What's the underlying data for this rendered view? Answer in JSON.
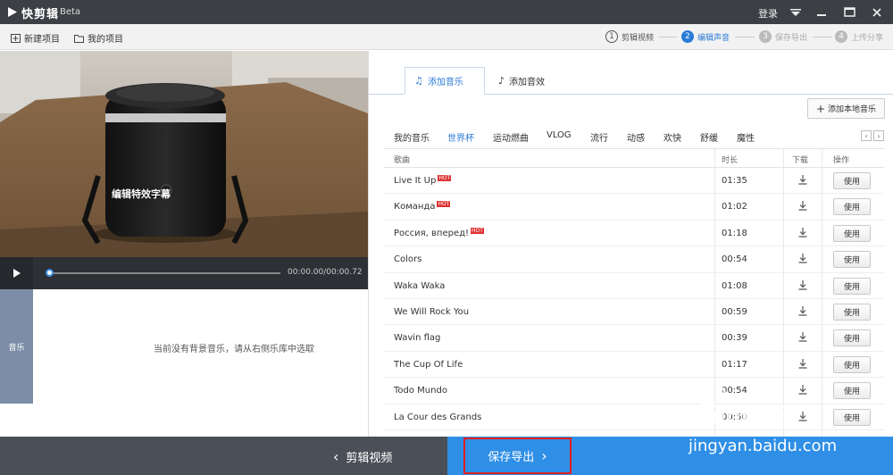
{
  "titlebar": {
    "app_title": "快剪辑",
    "beta": "Beta",
    "login": "登录"
  },
  "toolbar": {
    "new_project": "新建项目",
    "my_projects": "我的项目",
    "steps": [
      {
        "num": "1",
        "label": "剪辑视频"
      },
      {
        "num": "2",
        "label": "编辑声音"
      },
      {
        "num": "3",
        "label": "保存导出"
      },
      {
        "num": "4",
        "label": "上传分享"
      }
    ]
  },
  "preview": {
    "caption": "编辑特效字幕",
    "time": "00:00.00/00:00.72",
    "progress": 0
  },
  "music_track": {
    "label": "音乐",
    "empty_hint": "当前没有背景音乐，请从右侧乐库中选取"
  },
  "tabs": [
    {
      "label": "添加音乐",
      "icon": "music-note-icon"
    },
    {
      "label": "添加音效",
      "icon": "sound-effect-icon"
    }
  ],
  "add_local_music": "添加本地音乐",
  "categories": [
    "我的音乐",
    "世界杯",
    "运动燃曲",
    "VLOG",
    "流行",
    "动感",
    "欢快",
    "舒缓",
    "魔性"
  ],
  "table": {
    "headers": {
      "song": "歌曲",
      "duration": "时长",
      "download": "下载",
      "action": "操作"
    },
    "use_label": "使用",
    "hot_badge": "HOT",
    "rows": [
      {
        "name": "Live It Up",
        "hot": true,
        "duration": "01:35"
      },
      {
        "name": "Команда",
        "hot": true,
        "duration": "01:02"
      },
      {
        "name": "Россия, вперед!",
        "hot": true,
        "duration": "01:18"
      },
      {
        "name": "Colors",
        "hot": false,
        "duration": "00:54"
      },
      {
        "name": "Waka Waka",
        "hot": false,
        "duration": "01:08"
      },
      {
        "name": "We Will Rock You",
        "hot": false,
        "duration": "00:59"
      },
      {
        "name": "Wavin flag",
        "hot": false,
        "duration": "00:39"
      },
      {
        "name": "The Cup Of Life",
        "hot": false,
        "duration": "01:17"
      },
      {
        "name": "Todo Mundo",
        "hot": false,
        "duration": "00:54"
      },
      {
        "name": "La Cour des Grands",
        "hot": false,
        "duration": "00:50"
      }
    ]
  },
  "bottom": {
    "back": "剪辑视频",
    "save": "保存导出"
  },
  "watermark": {
    "brand": "Baidu经验",
    "url": "jingyan.baidu.com"
  },
  "colors": {
    "accent": "#2b7bd6",
    "save_bar": "#2f8fe6",
    "highlight_box": "#e02020"
  }
}
